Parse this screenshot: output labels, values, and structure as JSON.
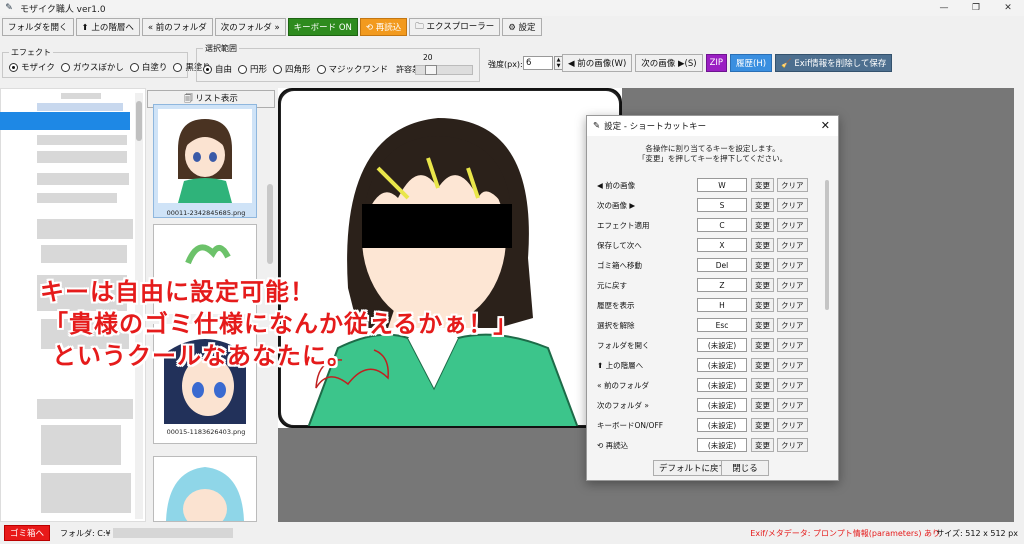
{
  "window": {
    "title": "モザイク職人 ver1.0",
    "controls": [
      "—",
      "❐",
      "✕"
    ]
  },
  "toolbar": {
    "open_folder": "フォルダを開く",
    "up_level": "⬆ 上の階層へ",
    "prev_folder": "« 前のフォルダ",
    "next_folder": "次のフォルダ »",
    "keyboard": "キーボード ON",
    "reload": "⟲ 再読込",
    "explorer": "🗀 エクスプローラー",
    "settings": "⚙ 設定"
  },
  "effect_group": {
    "legend": "エフェクト",
    "options": [
      "モザイク",
      "ガウスぼかし",
      "白塗り",
      "黒塗り"
    ],
    "selected": 0
  },
  "selection_group": {
    "legend": "選択範囲",
    "options": [
      "自由",
      "円形",
      "四角形",
      "マジックワンド"
    ],
    "selected": 0,
    "tolerance_label": "許容差:",
    "tolerance_value": "20",
    "tolerance_fraction": 0.2
  },
  "strength": {
    "label": "強度(px):",
    "value": "6"
  },
  "nav_buttons": {
    "prev_image": "◀ 前の画像(W)",
    "next_image": "次の画像 ▶(S)",
    "zip": "ZIP",
    "history": "履歴(H)",
    "exif_save": "🧹 Exif情報を削除して保存"
  },
  "thumbs": {
    "list_view": "🗐 リスト表示",
    "captions": [
      "00011-2342845685.png",
      "",
      "00015-1183626403.png",
      ""
    ]
  },
  "overlay": {
    "line1": "キーは自由に設定可能！",
    "line2": "「貴様のゴミ仕様になんか従えるかぁ！」",
    "line3": "というクールなあなたに。"
  },
  "dialog": {
    "title": "設定 - ショートカットキー",
    "desc1": "各操作に割り当てるキーを設定します。",
    "desc2": "「変更」を押してキーを押下してください。",
    "change": "変更",
    "clear": "クリア",
    "rows": [
      {
        "label": "◀ 前の画像",
        "key": "W"
      },
      {
        "label": "次の画像 ▶",
        "key": "S"
      },
      {
        "label": "エフェクト適用",
        "key": "C"
      },
      {
        "label": "保存して次へ",
        "key": "X"
      },
      {
        "label": "ゴミ箱へ移動",
        "key": "Del"
      },
      {
        "label": "元に戻す",
        "key": "Z"
      },
      {
        "label": "履歴を表示",
        "key": "H"
      },
      {
        "label": "選択を解除",
        "key": "Esc"
      },
      {
        "label": "フォルダを開く",
        "key": "(未設定)"
      },
      {
        "label": "⬆ 上の階層へ",
        "key": "(未設定)"
      },
      {
        "label": "« 前のフォルダ",
        "key": "(未設定)"
      },
      {
        "label": "次のフォルダ »",
        "key": "(未設定)"
      },
      {
        "label": "キーボードON/OFF",
        "key": "(未設定)"
      },
      {
        "label": "⟲ 再読込",
        "key": "(未設定)"
      }
    ],
    "default_btn": "デフォルトに戻す",
    "close_btn": "閉じる"
  },
  "status": {
    "trash": "ゴミ箱へ",
    "folder_label": "フォルダ: C:¥",
    "exif_info": "Exif/メタデータ: プロンプト情報(parameters) あり",
    "size": "サイズ: 512 x 512 px"
  },
  "colors": {
    "accent_blue": "#1e88e5",
    "keyboard_green": "#2e8b1e",
    "reload_orange": "#f29a1e",
    "zip_purple": "#9b1fc3",
    "alert_red": "#e51b1b"
  }
}
